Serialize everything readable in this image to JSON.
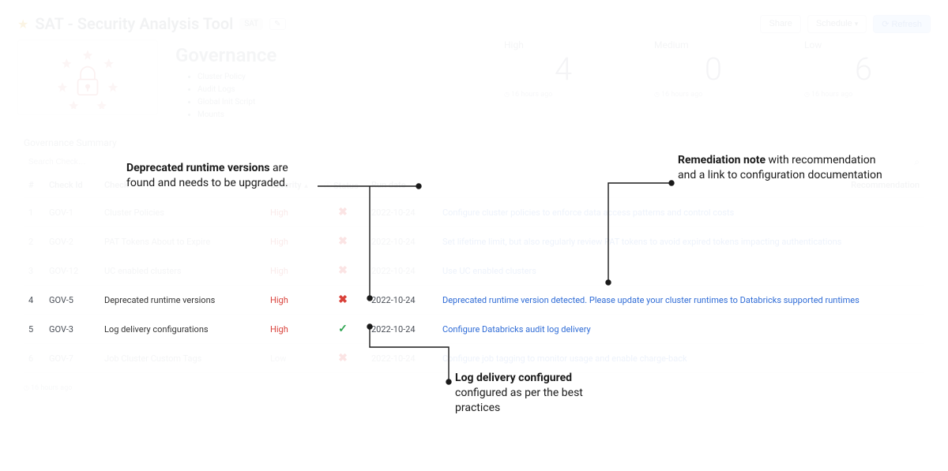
{
  "header": {
    "title": "SAT - Security Analysis Tool",
    "chip": "SAT",
    "share": "Share",
    "schedule": "Schedule",
    "refresh": "Refresh"
  },
  "governance": {
    "title": "Governance",
    "items": [
      "Cluster Policy",
      "Audit Logs",
      "Global Init Script",
      "Mounts"
    ]
  },
  "metrics": [
    {
      "label": "High",
      "value": "4",
      "time": "16 hours ago"
    },
    {
      "label": "Medium",
      "value": "0",
      "time": "16 hours ago"
    },
    {
      "label": "Low",
      "value": "6",
      "time": "16 hours ago"
    }
  ],
  "section_title": "Governance Summary",
  "search_placeholder": "Search Check…",
  "columns": {
    "idx": "#",
    "checkid": "Check Id",
    "name": "Check",
    "severity": "Severity",
    "status": "Status",
    "rundate": "Run date",
    "recommendation": "Recommendation"
  },
  "rows": [
    {
      "idx": "1",
      "id": "GOV-1",
      "name": "Cluster Policies",
      "sev": "High",
      "status": "x",
      "date": "2022-10-24",
      "rec": "Configure cluster policies to enforce data access patterns and control costs",
      "highlight": false
    },
    {
      "idx": "2",
      "id": "GOV-2",
      "name": "PAT Tokens About to Expire",
      "sev": "High",
      "status": "x",
      "date": "2022-10-24",
      "rec": "Set lifetime limit, but also regularly review PAT tokens to avoid expired tokens impacting authentications",
      "highlight": false
    },
    {
      "idx": "3",
      "id": "GOV-12",
      "name": "UC enabled clusters",
      "sev": "High",
      "status": "x",
      "date": "2022-10-24",
      "rec": "Use UC enabled clusters",
      "highlight": false
    },
    {
      "idx": "4",
      "id": "GOV-5",
      "name": "Deprecated runtime versions",
      "sev": "High",
      "status": "x",
      "date": "2022-10-24",
      "rec": "Deprecated runtime version detected. Please update your cluster runtimes to Databricks supported runtimes",
      "highlight": true
    },
    {
      "idx": "5",
      "id": "GOV-3",
      "name": "Log delivery configurations",
      "sev": "High",
      "status": "ok",
      "date": "2022-10-24",
      "rec": "Configure Databricks audit log delivery",
      "highlight": true
    },
    {
      "idx": "6",
      "id": "GOV-7",
      "name": "Job Cluster Custom Tags",
      "sev": "Low",
      "status": "x",
      "date": "2022-10-24",
      "rec": "Configure job tagging to monitor usage and enable charge-back",
      "highlight": false
    }
  ],
  "footer_time": "16 hours ago",
  "annotations": {
    "a1_bold": "Deprecated runtime versions",
    "a1_rest": " are found and needs to be upgraded.",
    "a2_bold": "Remediation note",
    "a2_rest": " with recommendation and a link to configuration documentation",
    "a3_bold": "Log delivery configured",
    "a3_rest": "  configured as per the best practices"
  }
}
